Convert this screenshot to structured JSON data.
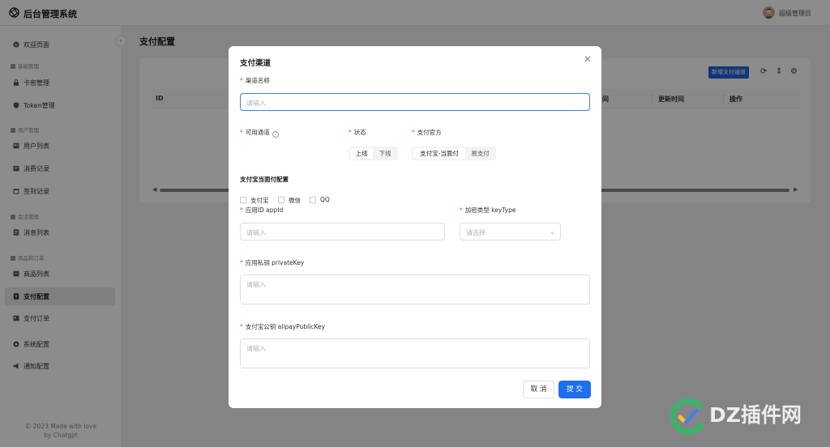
{
  "app": {
    "title": "后台管理系统",
    "user": "超级管理员"
  },
  "sidebar": {
    "items": [
      {
        "label": "欢迎页面",
        "icon": "smile-icon"
      },
      {
        "label": "卡密管理",
        "icon": "lock-icon"
      },
      {
        "label": "Token管理",
        "icon": "shield-icon"
      },
      {
        "label": "用户列表",
        "icon": "user-list-icon"
      },
      {
        "label": "消费记录",
        "icon": "record-icon"
      },
      {
        "label": "签到记录",
        "icon": "calendar-icon"
      },
      {
        "label": "消息列表",
        "icon": "message-icon"
      },
      {
        "label": "商品列表",
        "icon": "goods-icon"
      },
      {
        "label": "支付配置",
        "icon": "payment-icon"
      },
      {
        "label": "支付订单",
        "icon": "order-icon"
      },
      {
        "label": "系统配置",
        "icon": "gear-icon"
      },
      {
        "label": "通知配置",
        "icon": "bell-icon"
      }
    ],
    "groups": [
      "基础管理",
      "用户管理",
      "会话管理",
      "商品和订单"
    ],
    "active_item": "支付配置",
    "footer_line1": "© 2023 Made with love",
    "footer_line2": "by Chatgpt"
  },
  "main": {
    "page_title": "支付配置",
    "add_button": "新增支付通道",
    "table": {
      "columns": [
        "ID",
        "间",
        "更新时间",
        "操作"
      ]
    }
  },
  "modal": {
    "title": "支付渠道",
    "channel_name": {
      "label": "渠道名称",
      "placeholder": "请输入"
    },
    "available_channels": {
      "label": "可用通道",
      "options": [
        "支付宝",
        "微信",
        "QQ"
      ]
    },
    "status": {
      "label": "状态",
      "options": [
        "上线",
        "下线"
      ],
      "selected": "上线"
    },
    "payment_provider": {
      "label": "支付官方",
      "options": [
        "支付宝-当面付",
        "易支付"
      ],
      "selected": "支付宝-当面付"
    },
    "section_title": "支付宝当面付配置",
    "app_id": {
      "label": "应用ID appId",
      "placeholder": "请输入"
    },
    "key_type": {
      "label": "加密类型 keyType",
      "placeholder": "请选择"
    },
    "private_key": {
      "label": "应用私钥 privateKey",
      "placeholder": "请输入"
    },
    "alipay_public_key": {
      "label": "支付宝公钥 alipayPublicKey",
      "placeholder": "请输入"
    },
    "cancel_label": "取 消",
    "submit_label": "提 交"
  },
  "watermark": {
    "text": "DZ插件网"
  }
}
